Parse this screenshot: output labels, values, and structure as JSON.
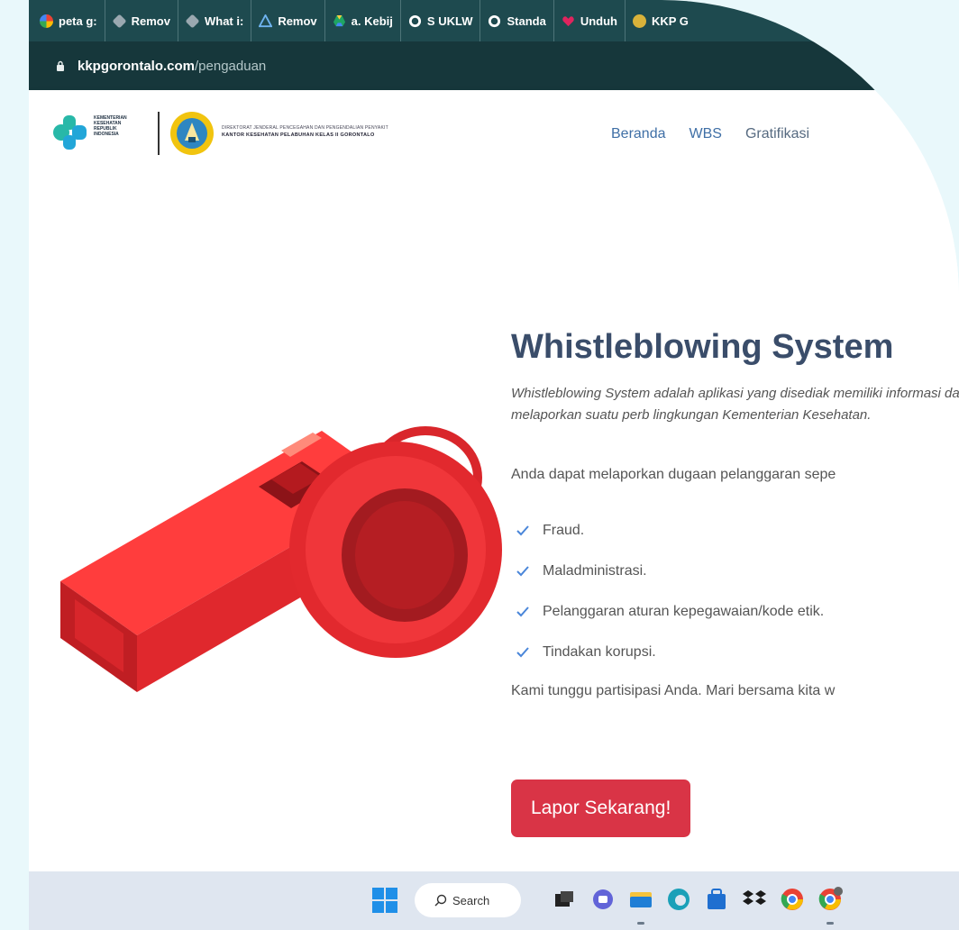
{
  "browser": {
    "bookmarks": [
      {
        "label": "peta g:",
        "icon": "google-icon",
        "color": "#4285f4"
      },
      {
        "label": "Remov",
        "icon": "diamond-icon",
        "color": "#9aa8b0"
      },
      {
        "label": "What i:",
        "icon": "diamond-icon",
        "color": "#9aa8b0"
      },
      {
        "label": "Remov",
        "icon": "triangle-logo-icon",
        "color": "#5aa0e0"
      },
      {
        "label": "a. Kebij",
        "icon": "google-drive-icon",
        "color": "#1fa463"
      },
      {
        "label": "S UKLW",
        "icon": "globe-icon",
        "color": "#ffffff"
      },
      {
        "label": "Standa",
        "icon": "globe-icon",
        "color": "#ffffff"
      },
      {
        "label": "Unduh",
        "icon": "heart-icon",
        "color": "#e0245e"
      },
      {
        "label": "KKP G",
        "icon": "crest-icon",
        "color": "#d9b23a"
      }
    ],
    "address": {
      "host": "kkpgorontalo.com",
      "path": "/pengaduan"
    }
  },
  "header": {
    "kemenkes_text": "KEMENTERIAN KESEHATAN REPUBLIK INDONESIA",
    "dirjen_text": "DIREKTORAT JENDERAL PENCEGAHAN DAN PENGENDALIAN PENYAKIT",
    "kkp_name": "KANTOR KESEHATAN PELABUHAN KELAS II GORONTALO",
    "nav": [
      "Beranda",
      "WBS",
      "Gratifikasi"
    ]
  },
  "main": {
    "title": "Whistleblowing System",
    "intro": "Whistleblowing System adalah aplikasi yang disediak memiliki informasi dan ingin melaporkan suatu perb lingkungan Kementerian Kesehatan.",
    "lead": "Anda dapat melaporkan dugaan pelanggaran sepe",
    "items": [
      "Fraud.",
      "Maladministrasi.",
      "Pelanggaran aturan kepegawaian/kode etik.",
      "Tindakan korupsi."
    ],
    "closing": "Kami tunggu partisipasi Anda. Mari bersama kita w",
    "cta_label": "Lapor Sekarang!"
  },
  "taskbar": {
    "search_label": "Search"
  },
  "colors": {
    "accent": "#d93446",
    "title": "#3a4d6a",
    "nav": "#3f6fa6",
    "check": "#4a86d9",
    "toolbar": "#1e4a4f"
  }
}
